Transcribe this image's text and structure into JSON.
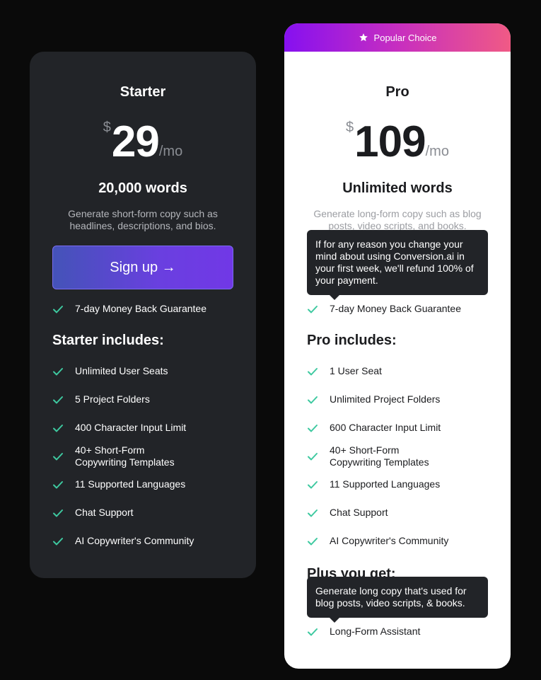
{
  "colors": {
    "page_bg": "#0a0a0a",
    "starter_card_bg": "#222428",
    "pro_card_bg": "#ffffff",
    "check_color": "#3ec9a0",
    "ribbon_gradient_start": "#8610f0",
    "ribbon_gradient_end": "#f05a85",
    "signup_gradient_start": "#4453b8",
    "signup_gradient_end": "#7138e6"
  },
  "starter": {
    "name": "Starter",
    "currency": "$",
    "amount": "29",
    "period": "/mo",
    "words": "20,000 words",
    "description": "Generate short-form copy such as headlines, descriptions, and bios.",
    "signup_label": "Sign up →",
    "guarantee": "7-day Money Back Guarantee",
    "includes_title": "Starter includes:",
    "features": [
      "Unlimited User Seats",
      "5 Project Folders",
      "400 Character Input Limit",
      "40+ Short-Form Copywriting Templates",
      "11 Supported Languages",
      "Chat Support",
      "AI Copywriter's Community"
    ]
  },
  "pro": {
    "badge": "Popular Choice",
    "badge_icon": "star-icon",
    "name": "Pro",
    "currency": "$",
    "amount": "109",
    "period": "/mo",
    "words": "Unlimited words",
    "description": "Generate long-form copy such as blog posts, video scripts, and books.",
    "guarantee_tooltip": "If for any reason you change your mind about using Conversion.ai in your first week, we'll refund 100% of your payment.",
    "guarantee": "7-day Money Back Guarantee",
    "includes_title": "Pro includes:",
    "features": [
      "1 User Seat",
      "Unlimited Project Folders",
      "600 Character Input Limit",
      "40+ Short-Form Copywriting Templates",
      "11 Supported Languages",
      "Chat Support",
      "AI Copywriter's Community"
    ],
    "plus_title": "Plus you get:",
    "plus_tooltip": "Generate long copy that's used for blog posts, video scripts, & books.",
    "plus_features": [
      "Long-Form Assistant"
    ]
  }
}
